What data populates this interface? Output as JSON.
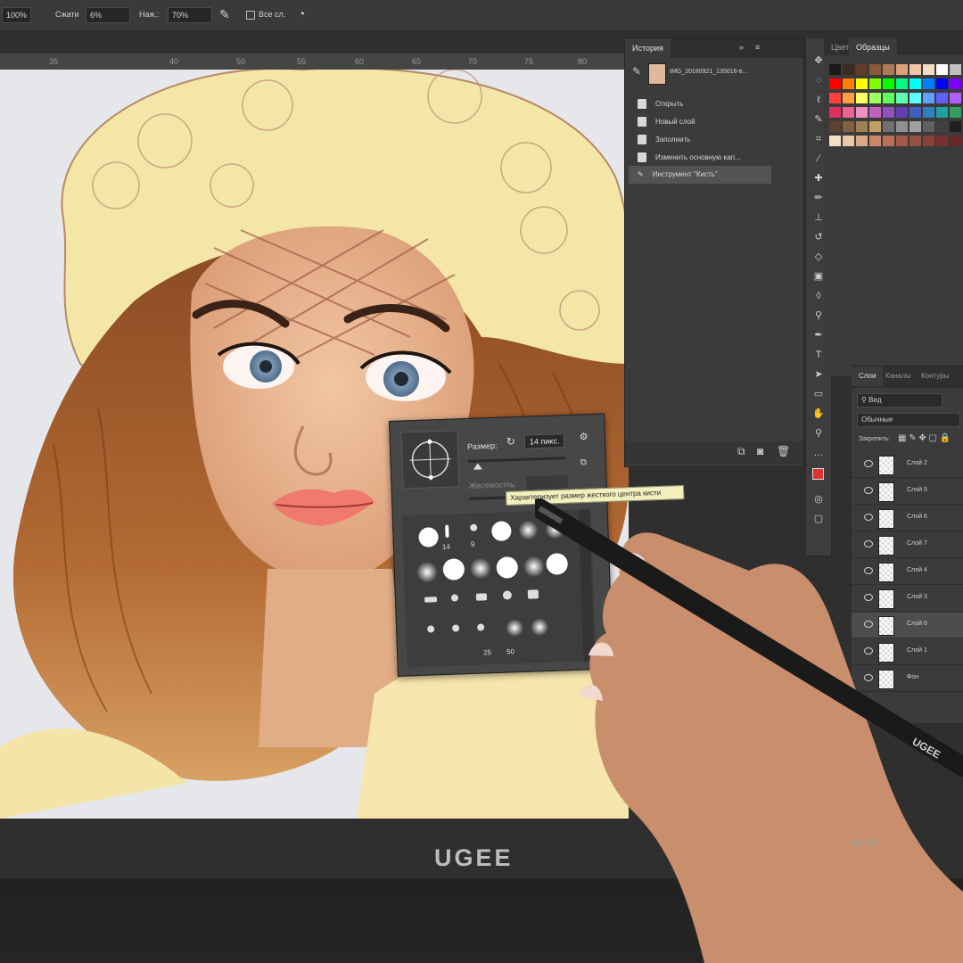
{
  "options_bar": {
    "zoom": "100%",
    "opacity_label": "Сжати",
    "opacity_value": "6%",
    "flow_label": "Наж.:",
    "flow_value": "70%",
    "sample_all_label": "Все сл."
  },
  "ruler": {
    "ticks": [
      "35",
      "40",
      "50",
      "55",
      "60",
      "65",
      "70",
      "75",
      "80"
    ]
  },
  "history_panel": {
    "tab_history": "История",
    "snapshot_label": "IMG_20180921_135016-в...",
    "items": [
      "Открыть",
      "Новый слой",
      "Заполнить",
      "Изменить основную кап...",
      "Инструмент \"Кисть\""
    ],
    "selected_index": 4
  },
  "swatches_panel": {
    "tab_inactive": "Цвет",
    "tab_active": "Образцы",
    "colors": [
      "#1a1a1a",
      "#3a2a22",
      "#5e3b2a",
      "#8b5a3c",
      "#b07a55",
      "#d9a07a",
      "#f0c6a4",
      "#f7dcc4",
      "#ffffff",
      "#c0c0c0",
      "#ff0000",
      "#ff8000",
      "#ffff00",
      "#80ff00",
      "#00ff00",
      "#00ff80",
      "#00ffff",
      "#0080ff",
      "#0000ff",
      "#8000ff",
      "#ff4040",
      "#ffa040",
      "#ffff60",
      "#a0ff60",
      "#60ff60",
      "#60ffb0",
      "#60ffff",
      "#60a0ff",
      "#6060ff",
      "#b060ff",
      "#e03060",
      "#f06090",
      "#f090c0",
      "#c060c0",
      "#9050c0",
      "#6040b0",
      "#4060c0",
      "#3080c0",
      "#20a0a0",
      "#30a060",
      "#604030",
      "#806040",
      "#a08050",
      "#c0a060",
      "#707070",
      "#909090",
      "#a0a0a0",
      "#606060",
      "#404040",
      "#202020",
      "#f2e0c8",
      "#e8c8a8",
      "#d8a888",
      "#c88868",
      "#b87058",
      "#a85848",
      "#985040",
      "#884038",
      "#783030",
      "#682828"
    ]
  },
  "layers_panel": {
    "tabs": [
      "Слои",
      "Каналы",
      "Контуры"
    ],
    "filter_label": "Вид",
    "blend_mode": "Обычные",
    "lock_label": "Закрепить:",
    "layers": [
      "Слой 2",
      "Слой 5",
      "Слой 6",
      "Слой 7",
      "Слой 4",
      "Слой 3",
      "Слой 6",
      "Слой 1",
      "Фон"
    ]
  },
  "brush_popup": {
    "size_label": "Размер:",
    "size_value": "14 пикс.",
    "hardness_label": "Жесткость:",
    "tooltip": "Характеризует размер жесткого центра кисти",
    "preset_numbers": [
      "14",
      "9",
      "25",
      "50"
    ]
  },
  "device": {
    "brand": "UGEE",
    "auto_label": "AUTO",
    "pen_brand": "UGEE"
  },
  "colors": {
    "panel_bg": "#3b3b3b",
    "app_bg": "#2f2f2f",
    "foreground": "#e0312e",
    "background": "#ffffff",
    "tooltip_bg": "#f3f0be"
  }
}
